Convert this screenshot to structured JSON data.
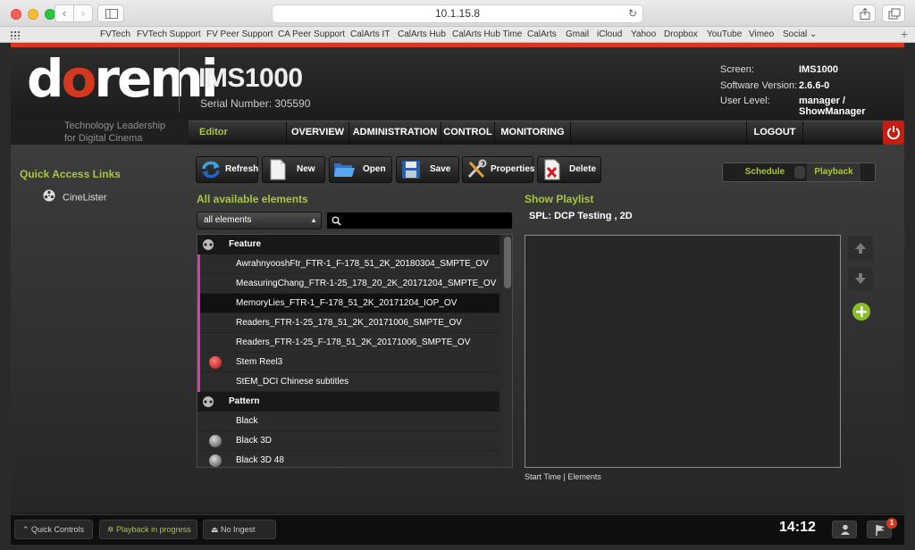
{
  "browser": {
    "url": "10.1.15.8",
    "bookmarks": [
      "FVTech",
      "FVTech Support",
      "FV Peer Support",
      "CA Peer Support",
      "CalArts IT",
      "CalArts Hub",
      "CalArts Hub Time",
      "CalArts",
      "Gmail",
      "iCloud",
      "Yahoo",
      "Dropbox",
      "YouTube",
      "Vimeo",
      "Social ⌄"
    ]
  },
  "header": {
    "logo": [
      "d",
      "o",
      "remi"
    ],
    "product": "IMS1000",
    "serial": "Serial Number: 305590",
    "tagline": "Technology Leadership for Digital Cinema",
    "info": {
      "screen_label": "Screen:",
      "screen_value": "IMS1000",
      "version_label": "Software Version:",
      "version_value": "2.6.6-0",
      "level_label": "User Level:",
      "level_value": "manager / ShowManager"
    }
  },
  "menu": {
    "editor": "Editor",
    "overview": "OVERVIEW",
    "administration": "ADMINISTRATION",
    "control": "CONTROL",
    "monitoring": "MONITORING",
    "logout": "LOGOUT"
  },
  "quick_access": {
    "title": "Quick Access Links",
    "links": [
      "CineLister"
    ]
  },
  "toolbar": {
    "refresh": "Refresh",
    "new": "New",
    "open": "Open",
    "save": "Save",
    "properties": "Properties",
    "delete": "Delete"
  },
  "mode_toggle": {
    "schedule": "Schedule",
    "playback": "Playback"
  },
  "elements": {
    "title": "All available elements",
    "filter": "all elements",
    "groups": [
      {
        "name": "Feature",
        "rows": [
          {
            "text": "AwrahnyooshFtr_FTR-1_F-178_51_2K_20180304_SMPTE_OV",
            "marked": true,
            "selected": false,
            "icon": ""
          },
          {
            "text": "MeasuringChang_FTR-1-25_178_20_2K_20171204_SMPTE_OV",
            "marked": true,
            "selected": false,
            "icon": ""
          },
          {
            "text": "MemoryLies_FTR-1_F-178_51_2K_20171204_IOP_OV",
            "marked": true,
            "selected": true,
            "icon": ""
          },
          {
            "text": "Readers_FTR-1-25_178_51_2K_20171006_SMPTE_OV",
            "marked": true,
            "selected": false,
            "icon": ""
          },
          {
            "text": "Readers_FTR-1-25_F-178_51_2K_20171006_SMPTE_OV",
            "marked": true,
            "selected": false,
            "icon": ""
          },
          {
            "text": "Stem Reel3",
            "marked": true,
            "selected": false,
            "icon": "lock-icon"
          },
          {
            "text": "StEM_DCI Chinese subtitles",
            "marked": true,
            "selected": false,
            "icon": ""
          }
        ]
      },
      {
        "name": "Pattern",
        "rows": [
          {
            "text": "Black",
            "marked": false,
            "selected": false,
            "icon": ""
          },
          {
            "text": "Black 3D",
            "marked": false,
            "selected": false,
            "icon": "3d-disc-icon"
          },
          {
            "text": "Black 3D 48",
            "marked": false,
            "selected": false,
            "icon": "3d-disc-icon"
          }
        ]
      }
    ]
  },
  "playlist": {
    "title": "Show Playlist",
    "spl": "SPL: DCP Testing , 2D",
    "footer": "Start Time | Elements"
  },
  "status": {
    "quick_controls": "Quick Controls",
    "playback": "Playback in progress",
    "ingest": "No Ingest",
    "clock": "14:12",
    "flag_count": "1"
  },
  "colors": {
    "accent": "#a8c640",
    "brand_red": "#d4391f",
    "marker": "#d63da9"
  }
}
